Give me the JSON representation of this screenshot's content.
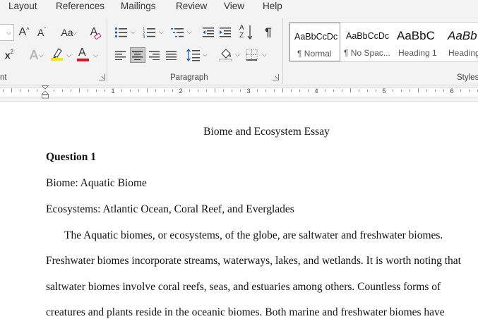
{
  "ribbon": {
    "tabs": [
      "Layout",
      "References",
      "Mailings",
      "Review",
      "View",
      "Help"
    ],
    "groups": {
      "font_label": "nt",
      "paragraph_label": "Paragraph",
      "styles_label": "Styles"
    },
    "font_buttons": {
      "grow": "A",
      "shrink": "A",
      "change_case": "Aa",
      "clear_format": "A",
      "superscript": "x",
      "text_effects": "A",
      "font_color": "A",
      "highlight_color": "#f5e900",
      "font_color_value": "#e0101e"
    },
    "paragraph_buttons": {
      "sort": "A",
      "sort2": "Z",
      "pilcrow": "¶"
    },
    "styles": [
      {
        "preview": "AaBbCcDc",
        "name": "¶ Normal",
        "active": true
      },
      {
        "preview": "AaBbCcDc",
        "name": "¶ No Spac..."
      },
      {
        "preview": "AaBbC",
        "name": "Heading 1"
      },
      {
        "preview": "AaBb",
        "name": "Heading"
      }
    ]
  },
  "ruler": {
    "numbers": [
      "1",
      "2",
      "3",
      "4",
      "5",
      "6"
    ]
  },
  "document": {
    "title": "Biome and Ecosystem Essay",
    "heading": "Question 1",
    "biome_line": "Biome: Aquatic Biome",
    "ecosystems_line": "Ecosystems: Atlantic Ocean, Coral Reef, and Everglades",
    "paragraph_lines": [
      "The Aquatic biomes, or ecosystems, of the globe, are saltwater and freshwater biomes.",
      "Freshwater biomes incorporate streams, waterways, lakes, and wetlands. It is worth noting that",
      "saltwater biomes involve coral reefs, seas, and estuaries among others. Countless forms of",
      "creatures and plants reside in the oceanic biomes. Both marine and freshwater biomes have"
    ]
  },
  "colors": {
    "ribbon_bg": "#f3f3f3",
    "highlight": "#f5e900",
    "font_red": "#e0101e"
  }
}
